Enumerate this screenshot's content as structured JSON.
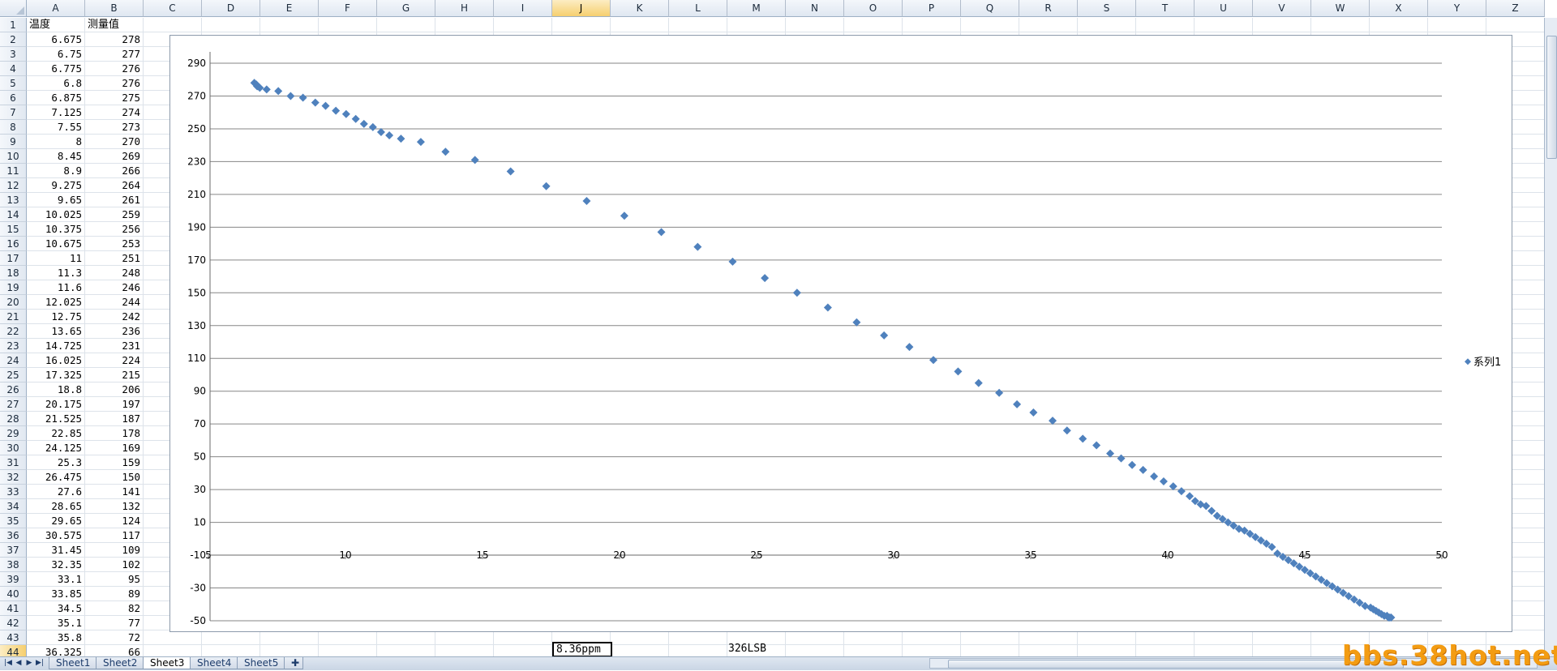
{
  "sheet": {
    "columns": [
      "A",
      "B",
      "C",
      "D",
      "E",
      "F",
      "G",
      "H",
      "I",
      "J",
      "K",
      "L",
      "M",
      "N",
      "O",
      "P",
      "Q",
      "R",
      "S",
      "T",
      "U",
      "V",
      "W",
      "X",
      "Y",
      "Z"
    ],
    "active_column": "J",
    "active_row": "44",
    "header_row": {
      "A": "温度",
      "B": "测量值"
    },
    "rows": [
      {
        "n": "2",
        "a": "6.675",
        "b": "278"
      },
      {
        "n": "3",
        "a": "6.75",
        "b": "277"
      },
      {
        "n": "4",
        "a": "6.775",
        "b": "276"
      },
      {
        "n": "5",
        "a": "6.8",
        "b": "276"
      },
      {
        "n": "6",
        "a": "6.875",
        "b": "275"
      },
      {
        "n": "7",
        "a": "7.125",
        "b": "274"
      },
      {
        "n": "8",
        "a": "7.55",
        "b": "273"
      },
      {
        "n": "9",
        "a": "8",
        "b": "270"
      },
      {
        "n": "10",
        "a": "8.45",
        "b": "269"
      },
      {
        "n": "11",
        "a": "8.9",
        "b": "266"
      },
      {
        "n": "12",
        "a": "9.275",
        "b": "264"
      },
      {
        "n": "13",
        "a": "9.65",
        "b": "261"
      },
      {
        "n": "14",
        "a": "10.025",
        "b": "259"
      },
      {
        "n": "15",
        "a": "10.375",
        "b": "256"
      },
      {
        "n": "16",
        "a": "10.675",
        "b": "253"
      },
      {
        "n": "17",
        "a": "11",
        "b": "251"
      },
      {
        "n": "18",
        "a": "11.3",
        "b": "248"
      },
      {
        "n": "19",
        "a": "11.6",
        "b": "246"
      },
      {
        "n": "20",
        "a": "12.025",
        "b": "244"
      },
      {
        "n": "21",
        "a": "12.75",
        "b": "242"
      },
      {
        "n": "22",
        "a": "13.65",
        "b": "236"
      },
      {
        "n": "23",
        "a": "14.725",
        "b": "231"
      },
      {
        "n": "24",
        "a": "16.025",
        "b": "224"
      },
      {
        "n": "25",
        "a": "17.325",
        "b": "215"
      },
      {
        "n": "26",
        "a": "18.8",
        "b": "206"
      },
      {
        "n": "27",
        "a": "20.175",
        "b": "197"
      },
      {
        "n": "28",
        "a": "21.525",
        "b": "187"
      },
      {
        "n": "29",
        "a": "22.85",
        "b": "178"
      },
      {
        "n": "30",
        "a": "24.125",
        "b": "169"
      },
      {
        "n": "31",
        "a": "25.3",
        "b": "159"
      },
      {
        "n": "32",
        "a": "26.475",
        "b": "150"
      },
      {
        "n": "33",
        "a": "27.6",
        "b": "141"
      },
      {
        "n": "34",
        "a": "28.65",
        "b": "132"
      },
      {
        "n": "35",
        "a": "29.65",
        "b": "124"
      },
      {
        "n": "36",
        "a": "30.575",
        "b": "117"
      },
      {
        "n": "37",
        "a": "31.45",
        "b": "109"
      },
      {
        "n": "38",
        "a": "32.35",
        "b": "102"
      },
      {
        "n": "39",
        "a": "33.1",
        "b": "95"
      },
      {
        "n": "40",
        "a": "33.85",
        "b": "89"
      },
      {
        "n": "41",
        "a": "34.5",
        "b": "82"
      },
      {
        "n": "42",
        "a": "35.1",
        "b": "77"
      },
      {
        "n": "43",
        "a": "35.8",
        "b": "72"
      },
      {
        "n": "44",
        "a": "36.325",
        "b": "66"
      }
    ],
    "cell_J44": "8.36ppm",
    "cell_M44": "326LSB"
  },
  "sheet_tabs": [
    "Sheet1",
    "Sheet2",
    "Sheet3",
    "Sheet4",
    "Sheet5"
  ],
  "active_sheet": "Sheet3",
  "nav_buttons": [
    "|◀",
    "◀",
    "▶",
    "▶|"
  ],
  "watermark": "bbs.38hot.net",
  "colors": {
    "marker": "#4f81bd",
    "gridline": "#868686",
    "header_bg": "#dfe7f1",
    "active_header": "#f6cf6f",
    "watermark": "#f39c12"
  },
  "chart_data": {
    "type": "scatter",
    "marker": "diamond",
    "xlim": [
      5,
      50
    ],
    "ylim": [
      -50,
      290
    ],
    "x_ticks": [
      "5",
      "10",
      "15",
      "20",
      "25",
      "30",
      "35",
      "40",
      "45",
      "50"
    ],
    "y_ticks": [
      "290",
      "270",
      "250",
      "230",
      "210",
      "190",
      "170",
      "150",
      "130",
      "110",
      "90",
      "70",
      "50",
      "30",
      "10",
      "-10",
      "-30",
      "-50"
    ],
    "grid": "horizontal",
    "legend_position": "right",
    "series": [
      {
        "name": "系列1",
        "x": [
          6.675,
          6.75,
          6.775,
          6.8,
          6.875,
          7.125,
          7.55,
          8,
          8.45,
          8.9,
          9.275,
          9.65,
          10.025,
          10.375,
          10.675,
          11,
          11.3,
          11.6,
          12.025,
          12.75,
          13.65,
          14.725,
          16.025,
          17.325,
          18.8,
          20.175,
          21.525,
          22.85,
          24.125,
          25.3,
          26.475,
          27.6,
          28.65,
          29.65,
          30.575,
          31.45,
          32.35,
          33.1,
          33.85,
          34.5,
          35.1,
          35.8,
          36.325,
          36.9,
          37.4,
          37.9,
          38.3,
          38.7,
          39.1,
          39.5,
          39.85,
          40.2,
          40.5,
          40.8,
          41.0,
          41.2,
          41.4,
          41.6,
          41.8,
          42.0,
          42.2,
          42.4,
          42.6,
          42.8,
          43.0,
          43.2,
          43.4,
          43.6,
          43.8,
          44.0,
          44.2,
          44.4,
          44.6,
          44.8,
          45.0,
          45.2,
          45.4,
          45.6,
          45.8,
          46.0,
          46.2,
          46.4,
          46.6,
          46.8,
          47.0,
          47.2,
          47.4,
          47.5,
          47.6,
          47.7,
          47.8,
          47.9,
          48.0,
          48.05,
          48.1,
          48.15
        ],
        "y": [
          278,
          277,
          276,
          276,
          275,
          274,
          273,
          270,
          269,
          266,
          264,
          261,
          259,
          256,
          253,
          251,
          248,
          246,
          244,
          242,
          236,
          231,
          224,
          215,
          206,
          197,
          187,
          178,
          169,
          159,
          150,
          141,
          132,
          124,
          117,
          109,
          102,
          95,
          89,
          82,
          77,
          72,
          66,
          61,
          57,
          52,
          49,
          45,
          42,
          38,
          35,
          32,
          29,
          26,
          23,
          21,
          20,
          17,
          14,
          12,
          10,
          8,
          6,
          5,
          3,
          1,
          -1,
          -3,
          -5,
          -9,
          -11,
          -13,
          -15,
          -17,
          -19,
          -21,
          -23,
          -25,
          -27,
          -29,
          -31,
          -33,
          -35,
          -37,
          -39,
          -41,
          -42,
          -43,
          -44,
          -45,
          -46,
          -47,
          -47,
          -48,
          -48,
          -48
        ]
      }
    ]
  }
}
